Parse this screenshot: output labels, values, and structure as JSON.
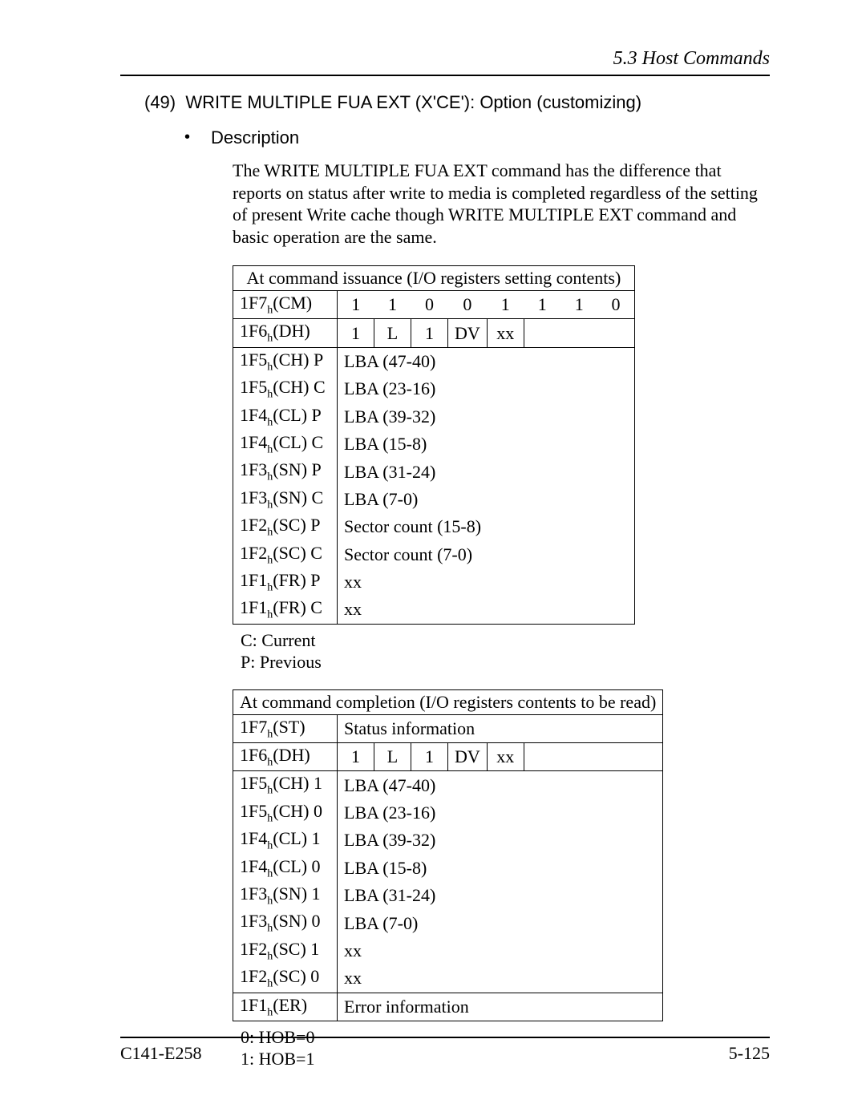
{
  "header": {
    "section": "5.3  Host Commands"
  },
  "title": {
    "num": "(49)",
    "text": "WRITE MULTIPLE FUA EXT (X'CE'):  Option (customizing)"
  },
  "bullet": {
    "label": "Description"
  },
  "paragraph": "The WRITE MULTIPLE FUA EXT command has the difference that reports on status after write to media is completed regardless of the setting of present Write cache though WRITE MULTIPLE EXT command and basic operation are the same.",
  "table1": {
    "caption": "At command issuance (I/O registers setting contents)",
    "rows": {
      "cm": {
        "reg": "1F7",
        "sub": "h",
        "suffix": "(CM)",
        "bits": [
          "1",
          "1",
          "0",
          "0",
          "1",
          "1",
          "1",
          "0"
        ]
      },
      "dh": {
        "reg": "1F6",
        "sub": "h",
        "suffix": "(DH)",
        "cells": [
          "1",
          "L",
          "1",
          "DV",
          "xx"
        ]
      },
      "chp": {
        "reg": "1F5",
        "sub": "h",
        "suffix": "(CH) P",
        "val": "LBA (47-40)"
      },
      "chc": {
        "reg": "1F5",
        "sub": "h",
        "suffix": "(CH) C",
        "val": "LBA (23-16)"
      },
      "clp": {
        "reg": "1F4",
        "sub": "h",
        "suffix": "(CL) P",
        "val": "LBA (39-32)"
      },
      "clc": {
        "reg": "1F4",
        "sub": "h",
        "suffix": "(CL) C",
        "val": "LBA (15-8)"
      },
      "snp": {
        "reg": "1F3",
        "sub": "h",
        "suffix": "(SN) P",
        "val": "LBA (31-24)"
      },
      "snc": {
        "reg": "1F3",
        "sub": "h",
        "suffix": "(SN) C",
        "val": "LBA (7-0)"
      },
      "scp": {
        "reg": "1F2",
        "sub": "h",
        "suffix": "(SC) P",
        "val": "Sector count (15-8)"
      },
      "scc": {
        "reg": "1F2",
        "sub": "h",
        "suffix": "(SC) C",
        "val": "Sector count (7-0)"
      },
      "frp": {
        "reg": "1F1",
        "sub": "h",
        "suffix": "(FR) P",
        "val": "xx"
      },
      "frc": {
        "reg": "1F1",
        "sub": "h",
        "suffix": "(FR) C",
        "val": "xx"
      }
    }
  },
  "notes1": {
    "line1": "C:  Current",
    "line2": "P:  Previous"
  },
  "table2": {
    "caption": "At command completion (I/O registers contents to be read)",
    "rows": {
      "st": {
        "reg": "1F7",
        "sub": "h",
        "suffix": "(ST)",
        "val": "Status information"
      },
      "dh": {
        "reg": "1F6",
        "sub": "h",
        "suffix": "(DH)",
        "cells": [
          "1",
          "L",
          "1",
          "DV",
          "xx"
        ]
      },
      "ch1": {
        "reg": "1F5",
        "sub": "h",
        "suffix": "(CH) 1",
        "val": "LBA (47-40)"
      },
      "ch0": {
        "reg": "1F5",
        "sub": "h",
        "suffix": "(CH) 0",
        "val": "LBA (23-16)"
      },
      "cl1": {
        "reg": "1F4",
        "sub": "h",
        "suffix": "(CL) 1",
        "val": "LBA (39-32)"
      },
      "cl0": {
        "reg": "1F4",
        "sub": "h",
        "suffix": "(CL) 0",
        "val": "LBA (15-8)"
      },
      "sn1": {
        "reg": "1F3",
        "sub": "h",
        "suffix": "(SN) 1",
        "val": "LBA (31-24)"
      },
      "sn0": {
        "reg": "1F3",
        "sub": "h",
        "suffix": "(SN) 0",
        "val": "LBA (7-0)"
      },
      "sc1": {
        "reg": "1F2",
        "sub": "h",
        "suffix": "(SC) 1",
        "val": "xx"
      },
      "sc0": {
        "reg": "1F2",
        "sub": "h",
        "suffix": "(SC) 0",
        "val": "xx"
      },
      "er": {
        "reg": "1F1",
        "sub": "h",
        "suffix": "(ER)",
        "val": "Error information"
      }
    }
  },
  "notes2": {
    "line1": "0:  HOB=0",
    "line2": "1:  HOB=1"
  },
  "footer": {
    "left": "C141-E258",
    "right": "5-125"
  }
}
